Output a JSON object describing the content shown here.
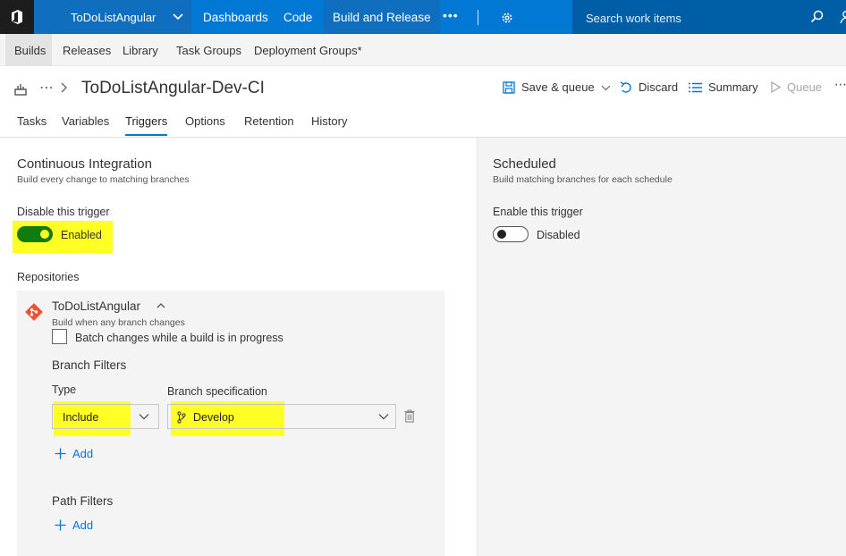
{
  "topbar": {
    "project": "ToDoListAngular",
    "nav": [
      "Dashboards",
      "Code",
      "Build and Release"
    ],
    "more": "•••",
    "search_placeholder": "Search work items"
  },
  "subnav": {
    "items": [
      "Builds",
      "Releases",
      "Library",
      "Task Groups",
      "Deployment Groups*"
    ]
  },
  "pipeline": {
    "dots": "⋯",
    "title": "ToDoListAngular-Dev-CI",
    "actions": {
      "save_queue": "Save & queue",
      "discard": "Discard",
      "summary": "Summary",
      "queue": "Queue"
    },
    "more": "⋯"
  },
  "tabs": [
    "Tasks",
    "Variables",
    "Triggers",
    "Options",
    "Retention",
    "History"
  ],
  "ci": {
    "title": "Continuous Integration",
    "subtitle": "Build every change to matching branches",
    "toggle_label": "Disable this trigger",
    "toggle_state": "Enabled",
    "repositories_label": "Repositories",
    "repo": {
      "name": "ToDoListAngular",
      "sub": "Build when any branch changes",
      "batch_label": "Batch changes while a build is in progress",
      "branch_filters_label": "Branch Filters",
      "type_label": "Type",
      "branch_spec_label": "Branch specification",
      "type_value": "Include",
      "branch_value": "Develop",
      "add_label": "Add",
      "path_filters_label": "Path Filters",
      "path_add_label": "Add"
    }
  },
  "scheduled": {
    "title": "Scheduled",
    "subtitle": "Build matching branches for each schedule",
    "toggle_label": "Enable this trigger",
    "toggle_state": "Disabled"
  },
  "colors": {
    "topbar": "#0078d4",
    "accent": "#0078d4",
    "toggle_on": "#107c10",
    "highlight": "#ffff26",
    "git": "#f05133"
  }
}
